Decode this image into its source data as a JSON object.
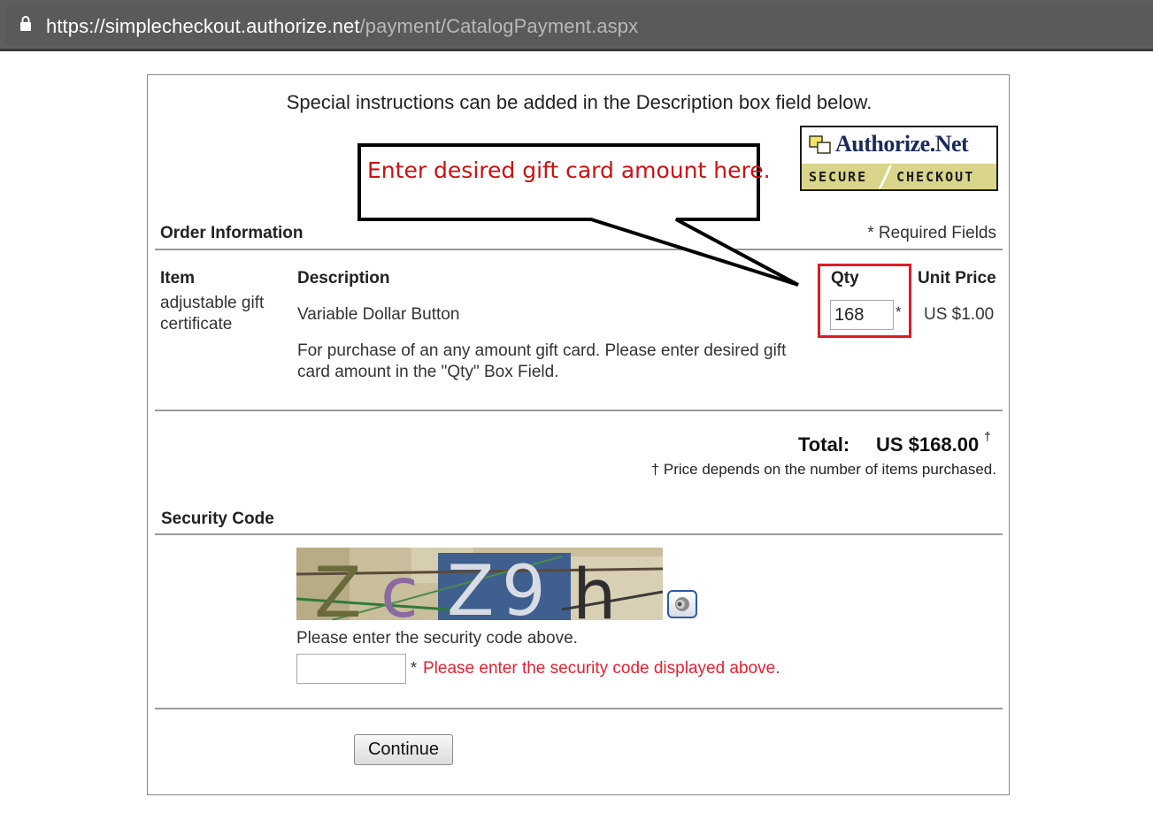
{
  "browser": {
    "url_host": "https://simplecheckout.authorize.net",
    "url_path": "/payment/CatalogPayment.aspx"
  },
  "page": {
    "instructions": "Special instructions can be added in the Description box field below.",
    "logo": {
      "name": "Authorize.Net",
      "secure": "SECURE",
      "checkout": "CHECKOUT"
    },
    "order": {
      "title": "Order Information",
      "required_note": "* Required Fields",
      "headers": {
        "item": "Item",
        "description": "Description",
        "qty": "Qty",
        "unit_price": "Unit Price"
      },
      "item_name_line1": "adjustable gift",
      "item_name_line2": "certificate",
      "description_title": "Variable Dollar Button",
      "description_line1": "For purchase of an any amount gift card. Please enter desired gift",
      "description_line2": "card amount in the \"Qty\" Box Field.",
      "qty_value": "168",
      "qty_required_mark": "*",
      "unit_price": "US $1.00"
    },
    "total": {
      "label": "Total:",
      "value": "US $168.00",
      "dagger": "†",
      "note": "† Price depends on the number of items purchased."
    },
    "security": {
      "title": "Security Code",
      "captcha_text": "zczgh",
      "prompt": "Please enter the security code above.",
      "input_value": "",
      "required_mark": "*",
      "error": "Please enter the security code displayed above."
    },
    "continue_label": "Continue"
  },
  "annotation": {
    "callout_text": "Enter desired gift card amount here.",
    "highlight_color": "#e01b24",
    "callout_text_color": "#cc1111"
  },
  "icons": [
    "lock-icon",
    "authorize-net-logo",
    "audio-icon"
  ]
}
